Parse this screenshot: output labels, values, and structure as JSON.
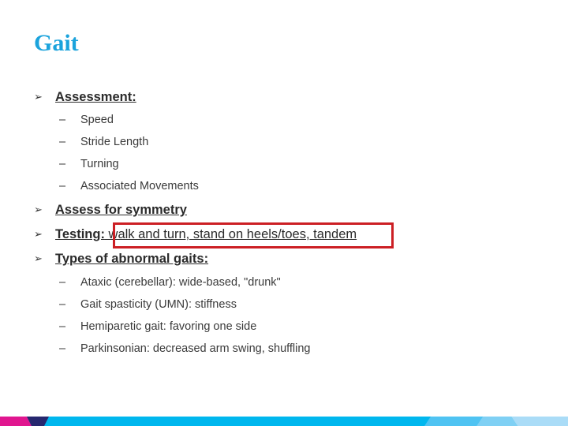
{
  "slide": {
    "title": "Gait",
    "colors": {
      "title": "#1ba3dc",
      "highlight_border": "#cc1f24",
      "footer": [
        "#e0168f",
        "#26276e",
        "#00b7ee",
        "#4fc3f2",
        "#7fd0f4",
        "#aadcf7"
      ]
    },
    "bullets": [
      {
        "icon": "arrow-bullet-icon",
        "bullet_glyph": "➢",
        "label": "Assessment:",
        "rest": "",
        "subitems": [
          {
            "dash": "–",
            "text": "Speed"
          },
          {
            "dash": "–",
            "text": "Stride Length"
          },
          {
            "dash": "–",
            "text": "Turning"
          },
          {
            "dash": "–",
            "text": "Associated Movements"
          }
        ]
      },
      {
        "icon": "arrow-bullet-icon",
        "bullet_glyph": "➢",
        "label": "Assess for symmetry",
        "rest": "",
        "subitems": []
      },
      {
        "icon": "arrow-bullet-icon",
        "bullet_glyph": "➢",
        "label": "Testing:",
        "rest": " walk and turn, stand on heels/toes, tandem",
        "highlighted": true,
        "subitems": []
      },
      {
        "icon": "arrow-bullet-icon",
        "bullet_glyph": "➢",
        "label": "Types of abnormal gaits:",
        "rest": "",
        "subitems": [
          {
            "dash": "–",
            "text": "Ataxic (cerebellar): wide-based, \"drunk\""
          },
          {
            "dash": "–",
            "text": "Gait spasticity (UMN): stiffness"
          },
          {
            "dash": "–",
            "text": "Hemiparetic gait: favoring one side"
          },
          {
            "dash": "–",
            "text": "Parkinsonian: decreased arm swing, shuffling"
          }
        ]
      }
    ]
  }
}
